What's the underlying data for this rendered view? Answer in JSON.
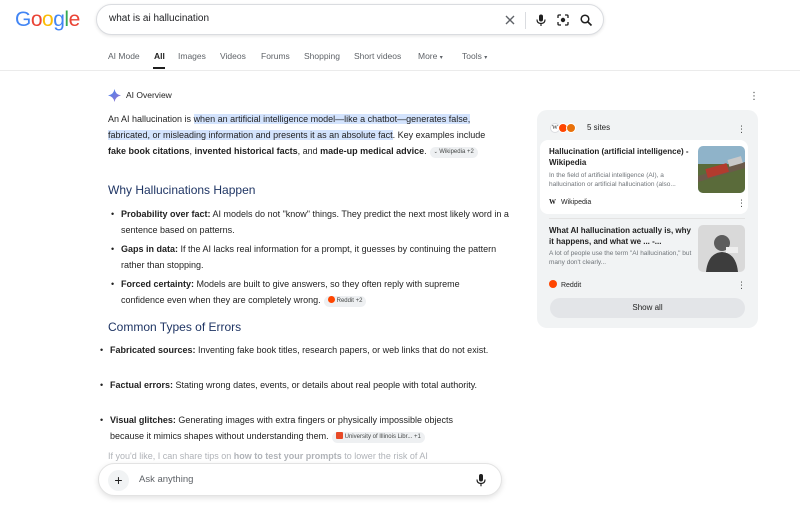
{
  "search": {
    "query": "what is ai hallucination"
  },
  "tabs": [
    {
      "label": "AI Mode"
    },
    {
      "label": "All"
    },
    {
      "label": "Images"
    },
    {
      "label": "Videos"
    },
    {
      "label": "Forums"
    },
    {
      "label": "Shopping"
    },
    {
      "label": "Short videos"
    },
    {
      "label": "More"
    },
    {
      "label": "Tools"
    }
  ],
  "ai_overview": {
    "label": "AI Overview",
    "intro": {
      "lead": "An AI hallucination is ",
      "highlight": "when an artificial intelligence model—like a chatbot—generates false, fabricated, or misleading information and presents it as an absolute fact",
      "after": ". Key examples include ",
      "b1": "fake book citations",
      "sep1": ", ",
      "b2": "invented historical facts",
      "sep2": ", and ",
      "b3": "made-up medical advice",
      "end": ".",
      "chip": "Wikipedia +2"
    },
    "section1": {
      "heading": "Why Hallucinations Happen",
      "items": [
        {
          "term": "Probability over fact:",
          "text": " AI models do not \"know\" things. They predict the next most likely word in a sentence based on patterns."
        },
        {
          "term": "Gaps in data:",
          "text": " If the AI lacks real information for a prompt, it guesses by continuing the pattern rather than stopping."
        },
        {
          "term": "Forced certainty:",
          "text": " Models are built to give answers, so they often reply with supreme confidence even when they are completely wrong.",
          "chip": "Reddit +2"
        }
      ]
    },
    "section2": {
      "heading": "Common Types of Errors",
      "items": [
        {
          "term": "Fabricated sources:",
          "text": " Inventing fake book titles, research papers, or web links that do not exist."
        },
        {
          "term": "Factual errors:",
          "text": " Stating wrong dates, events, or details about real people with total authority."
        },
        {
          "term": "Visual glitches:",
          "text": " Generating images with extra fingers or physically impossible objects because it mimics shapes without understanding them.",
          "chip": "University of Illinois Libr...",
          "chip2": "+1"
        }
      ]
    },
    "faded": {
      "lead": "If you'd like, I can share tips on ",
      "bold": "how to test your prompts",
      "after": " to lower the risk of AI"
    }
  },
  "ask": {
    "placeholder": "Ask anything"
  },
  "sources_panel": {
    "count_label": "5 sites",
    "cards": [
      {
        "title": "Hallucination (artificial intelligence) - Wikipedia",
        "snippet": "In the field of artificial intelligence (AI), a hallucination or artificial hallucination (also...",
        "source": "Wikipedia"
      },
      {
        "title": "What AI hallucination actually is, why it happens, and what we ... -...",
        "snippet": "A lot of people use the term \"AI hallucination,\" but many don't clearly...",
        "source": "Reddit"
      }
    ],
    "show_all": "Show all"
  },
  "colors": {
    "highlight": "#d3e3fd",
    "heading": "#1f3564",
    "panel_bg": "#f1f3f4"
  }
}
